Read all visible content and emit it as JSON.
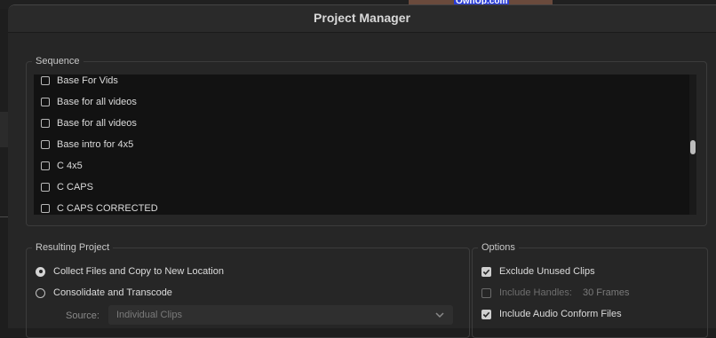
{
  "background": {
    "thumbnail_text": "OwnUp.com"
  },
  "dialog": {
    "title": "Project Manager"
  },
  "sequence": {
    "legend": "Sequence",
    "items": [
      {
        "label": "Base For Vids",
        "checked": false
      },
      {
        "label": "Base for all videos",
        "checked": false
      },
      {
        "label": "Base for all videos",
        "checked": false
      },
      {
        "label": "Base intro for 4x5",
        "checked": false
      },
      {
        "label": "C 4x5",
        "checked": false
      },
      {
        "label": "C CAPS",
        "checked": false
      },
      {
        "label": "C CAPS CORRECTED",
        "checked": false
      }
    ]
  },
  "resulting_project": {
    "legend": "Resulting Project",
    "options": [
      {
        "label": "Collect Files and Copy to New Location",
        "selected": true
      },
      {
        "label": "Consolidate and Transcode",
        "selected": false
      }
    ],
    "source_label": "Source:",
    "source_value": "Individual Clips"
  },
  "options": {
    "legend": "Options",
    "exclude_unused": {
      "label": "Exclude Unused Clips",
      "checked": true
    },
    "include_handles": {
      "label": "Include Handles:",
      "value": "30 Frames",
      "checked": false,
      "enabled": false
    },
    "include_audio_conform": {
      "label": "Include Audio Conform Files",
      "checked": true
    }
  },
  "colors": {
    "dialog_bg": "#262626",
    "list_bg": "#121212",
    "text": "#dcdcdc",
    "disabled_text": "#6e6e6e"
  }
}
